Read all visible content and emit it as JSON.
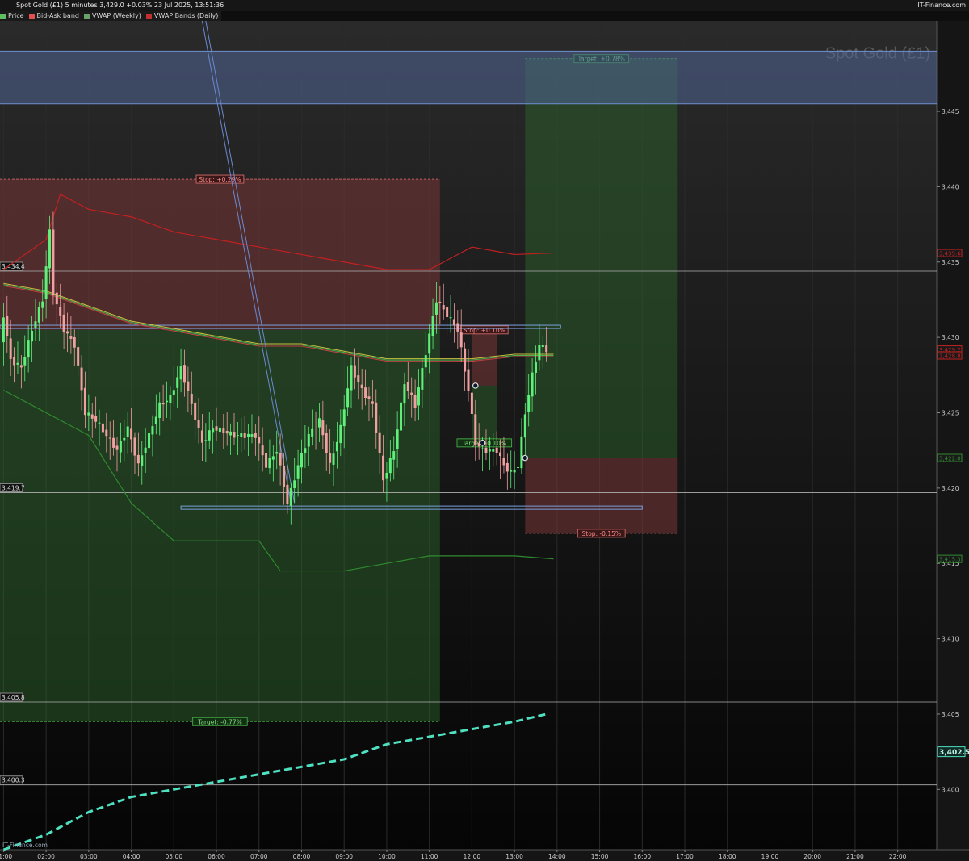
{
  "header": {
    "title": "Spot Gold (£1) 5 minutes 3,429.0 +0.03% 23 Jul 2025, 13:51:36",
    "brand": "IT-Finance.com",
    "watermark": "Spot Gold (£1)",
    "footer_logo": "IT-Finance.com"
  },
  "legend": [
    {
      "label": "Price",
      "color": "#5fbf5f"
    },
    {
      "label": "Bid-Ask band",
      "color": "#e05050"
    },
    {
      "label": "VWAP (Weekly)",
      "color": "#6aa06a"
    },
    {
      "label": "VWAP Bands (Daily)",
      "color": "#c03030"
    }
  ],
  "colors": {
    "up": "#5ff07a",
    "down": "#f0a0a0",
    "vwap_weekly_upper": "#c42020",
    "vwap_weekly_lower": "#2f8a2f",
    "daily_vwap": "#4fe0c0",
    "level_line": "#b0b0b0",
    "zone_blue": "#4a5f92",
    "zone_red": "#5a3232",
    "zone_green": "#1f4a1f"
  },
  "chart_data": {
    "type": "candlestick",
    "title": "Spot Gold (£1)",
    "interval": "5 minutes",
    "ylim": [
      3396,
      3451
    ],
    "xlim": [
      "00:55",
      "22:55"
    ],
    "x_ticks": [
      "01:00",
      "02:00",
      "03:00",
      "04:00",
      "05:00",
      "06:00",
      "07:00",
      "08:00",
      "09:00",
      "10:00",
      "11:00",
      "12:00",
      "13:00",
      "14:00",
      "15:00",
      "16:00",
      "17:00",
      "18:00",
      "19:00",
      "20:00",
      "21:00",
      "22:00"
    ],
    "y_ticks": [
      "3,400",
      "3,405",
      "3,410",
      "3,415",
      "3,420",
      "3,425",
      "3,430",
      "3,435",
      "3,440",
      "3,445"
    ],
    "price_path": [
      [
        "01:00",
        3429.5
      ],
      [
        "01:05",
        3431.5
      ],
      [
        "01:15",
        3428.5
      ],
      [
        "01:30",
        3428.0
      ],
      [
        "01:45",
        3430.5
      ],
      [
        "02:00",
        3432.5
      ],
      [
        "02:10",
        3437.0
      ],
      [
        "02:15",
        3433.0
      ],
      [
        "02:30",
        3430.5
      ],
      [
        "02:45",
        3429.5
      ],
      [
        "03:00",
        3425.0
      ],
      [
        "03:15",
        3424.5
      ],
      [
        "03:30",
        3423.5
      ],
      [
        "03:45",
        3422.5
      ],
      [
        "04:00",
        3424.0
      ],
      [
        "04:15",
        3421.5
      ],
      [
        "04:30",
        3423.5
      ],
      [
        "04:45",
        3425.5
      ],
      [
        "05:00",
        3426.0
      ],
      [
        "05:15",
        3428.0
      ],
      [
        "05:30",
        3425.5
      ],
      [
        "05:45",
        3423.0
      ],
      [
        "06:00",
        3424.0
      ],
      [
        "06:30",
        3423.5
      ],
      [
        "07:00",
        3423.5
      ],
      [
        "07:15",
        3421.5
      ],
      [
        "07:30",
        3422.5
      ],
      [
        "07:45",
        3419.0
      ],
      [
        "08:00",
        3421.5
      ],
      [
        "08:15",
        3423.5
      ],
      [
        "08:30",
        3424.5
      ],
      [
        "08:45",
        3421.5
      ],
      [
        "09:00",
        3424.0
      ],
      [
        "09:15",
        3428.0
      ],
      [
        "09:30",
        3426.5
      ],
      [
        "09:45",
        3425.5
      ],
      [
        "10:00",
        3420.5
      ],
      [
        "10:15",
        3422.5
      ],
      [
        "10:30",
        3427.0
      ],
      [
        "10:45",
        3425.5
      ],
      [
        "11:00",
        3429.0
      ],
      [
        "11:15",
        3432.5
      ],
      [
        "11:30",
        3431.5
      ],
      [
        "11:45",
        3430.5
      ],
      [
        "12:00",
        3426.5
      ],
      [
        "12:10",
        3423.0
      ],
      [
        "12:20",
        3422.5
      ],
      [
        "12:40",
        3422.5
      ],
      [
        "12:50",
        3421.5
      ],
      [
        "13:00",
        3421.0
      ],
      [
        "13:10",
        3421.5
      ],
      [
        "13:20",
        3425.0
      ],
      [
        "13:30",
        3427.5
      ],
      [
        "13:40",
        3429.5
      ],
      [
        "13:50",
        3429.2
      ]
    ],
    "vwap_weekly_upper": [
      [
        "01:00",
        3434.5
      ],
      [
        "02:00",
        3436.5
      ],
      [
        "02:20",
        3439.5
      ],
      [
        "03:00",
        3438.5
      ],
      [
        "04:00",
        3438.0
      ],
      [
        "05:00",
        3437.0
      ],
      [
        "06:00",
        3436.5
      ],
      [
        "07:00",
        3436.0
      ],
      [
        "08:00",
        3435.5
      ],
      [
        "09:00",
        3435.0
      ],
      [
        "10:00",
        3434.5
      ],
      [
        "11:00",
        3434.5
      ],
      [
        "11:20",
        3435.0
      ],
      [
        "12:00",
        3436.0
      ],
      [
        "13:00",
        3435.5
      ],
      [
        "13:55",
        3435.6
      ]
    ],
    "vwap_weekly_lower": [
      [
        "01:00",
        3426.5
      ],
      [
        "02:00",
        3425.0
      ],
      [
        "03:00",
        3423.5
      ],
      [
        "04:00",
        3419.0
      ],
      [
        "05:00",
        3416.5
      ],
      [
        "06:00",
        3416.5
      ],
      [
        "07:00",
        3416.5
      ],
      [
        "07:30",
        3414.5
      ],
      [
        "08:00",
        3414.5
      ],
      [
        "09:00",
        3414.5
      ],
      [
        "10:00",
        3415.0
      ],
      [
        "11:00",
        3415.5
      ],
      [
        "12:00",
        3415.5
      ],
      [
        "13:00",
        3415.5
      ],
      [
        "13:55",
        3415.3
      ]
    ],
    "daily_vwap": [
      [
        "01:00",
        3396.0
      ],
      [
        "02:00",
        3397.0
      ],
      [
        "03:00",
        3398.5
      ],
      [
        "04:00",
        3399.5
      ],
      [
        "05:00",
        3400.0
      ],
      [
        "06:00",
        3400.5
      ],
      [
        "07:00",
        3401.0
      ],
      [
        "08:00",
        3401.5
      ],
      [
        "09:00",
        3402.0
      ],
      [
        "10:00",
        3403.0
      ],
      [
        "11:00",
        3403.5
      ],
      [
        "12:00",
        3404.0
      ],
      [
        "13:00",
        3404.5
      ],
      [
        "13:45",
        3405.0
      ]
    ],
    "vwap_mid": [
      [
        "01:00",
        3433.5
      ],
      [
        "02:00",
        3433.0
      ],
      [
        "03:00",
        3432.0
      ],
      [
        "04:00",
        3431.0
      ],
      [
        "05:00",
        3430.5
      ],
      [
        "06:00",
        3430.0
      ],
      [
        "07:00",
        3429.5
      ],
      [
        "08:00",
        3429.5
      ],
      [
        "09:00",
        3429.0
      ],
      [
        "10:00",
        3428.5
      ],
      [
        "11:00",
        3428.5
      ],
      [
        "12:00",
        3428.5
      ],
      [
        "13:00",
        3428.8
      ],
      [
        "13:55",
        3428.8
      ]
    ],
    "hlines": [
      {
        "value": 3434.4,
        "label": "3,434.4"
      },
      {
        "value": 3419.7,
        "label": "3,419.7"
      },
      {
        "value": 3405.8,
        "label": "3,405.8"
      },
      {
        "value": 3400.3,
        "label": "3,400.3"
      }
    ],
    "price_tags": [
      {
        "value": 3435.6,
        "label": "3,435.6",
        "color": "#c42020"
      },
      {
        "value": 3429.2,
        "label": "3,429.2",
        "color": "#c42020"
      },
      {
        "value": 3428.8,
        "label": "3,428.8",
        "color": "#c42020"
      },
      {
        "value": 3422.0,
        "label": "3,422.0",
        "color": "#2f8a2f"
      },
      {
        "value": 3415.3,
        "label": "3,415.3",
        "color": "#2f8a2f"
      },
      {
        "value": 3402.5,
        "label": "3,402.5",
        "color": "#4fe0c0"
      }
    ],
    "zones": [
      {
        "kind": "stop",
        "from": "00:55",
        "to": "11:15",
        "top": 3440.5,
        "bottom": 3430.5,
        "label": "Stop: +0.29%"
      },
      {
        "kind": "target",
        "from": "00:55",
        "to": "11:15",
        "top": 3430.5,
        "bottom": 3404.5,
        "label": "Target: -0.77%"
      },
      {
        "kind": "stop",
        "from": "12:00",
        "to": "12:35",
        "top": 3430.5,
        "bottom": 3426.8,
        "label": "Stop: +0.10%"
      },
      {
        "kind": "target",
        "from": "12:00",
        "to": "12:35",
        "top": 3426.8,
        "bottom": 3423.0,
        "label": "Target: -0.10%"
      },
      {
        "kind": "target",
        "from": "13:15",
        "to": "16:50",
        "top": 3448.5,
        "bottom": 3422.0,
        "label": "Target: +0.78%"
      },
      {
        "kind": "stop",
        "from": "13:15",
        "to": "16:50",
        "top": 3422.0,
        "bottom": 3417.0,
        "label": "Stop: -0.15%"
      },
      {
        "kind": "resistance",
        "from": "00:55",
        "to": "22:55",
        "top": 3449.0,
        "bottom": 3445.5,
        "label": ""
      }
    ],
    "trend_lines": [
      {
        "from": [
          "05:40",
          3451.0
        ],
        "to": [
          "07:45",
          3419.0
        ]
      },
      {
        "from": [
          "05:45",
          3451.0
        ],
        "to": [
          "07:50",
          3419.0
        ]
      }
    ],
    "support_levels": [
      {
        "from": "05:10",
        "to": "16:00",
        "value": 3418.7
      },
      {
        "from": "00:55",
        "to": "14:05",
        "value": 3430.7
      }
    ],
    "markers": [
      {
        "time": "12:05",
        "value": 3426.8
      },
      {
        "time": "12:15",
        "value": 3423.0
      },
      {
        "time": "13:15",
        "value": 3422.0
      }
    ]
  }
}
